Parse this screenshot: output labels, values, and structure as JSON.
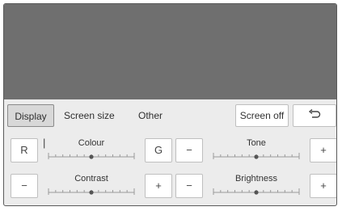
{
  "tabs": {
    "display": "Display",
    "screen_size": "Screen size",
    "other": "Other"
  },
  "buttons": {
    "screen_off": "Screen off",
    "back_glyph": "⮌"
  },
  "controls": {
    "colour": {
      "label": "Colour",
      "left": "R",
      "right": "G",
      "level": 0.5
    },
    "tone": {
      "label": "Tone",
      "left": "−",
      "right": "+",
      "level": 0.5
    },
    "contrast": {
      "label": "Contrast",
      "left": "−",
      "right": "+",
      "level": 0.5
    },
    "brightness": {
      "label": "Brightness",
      "left": "−",
      "right": "+",
      "level": 0.5
    }
  },
  "colors": {
    "screen": "#6f6f6f",
    "panel": "#ececec",
    "selected_tab": "#d8d8d8"
  }
}
